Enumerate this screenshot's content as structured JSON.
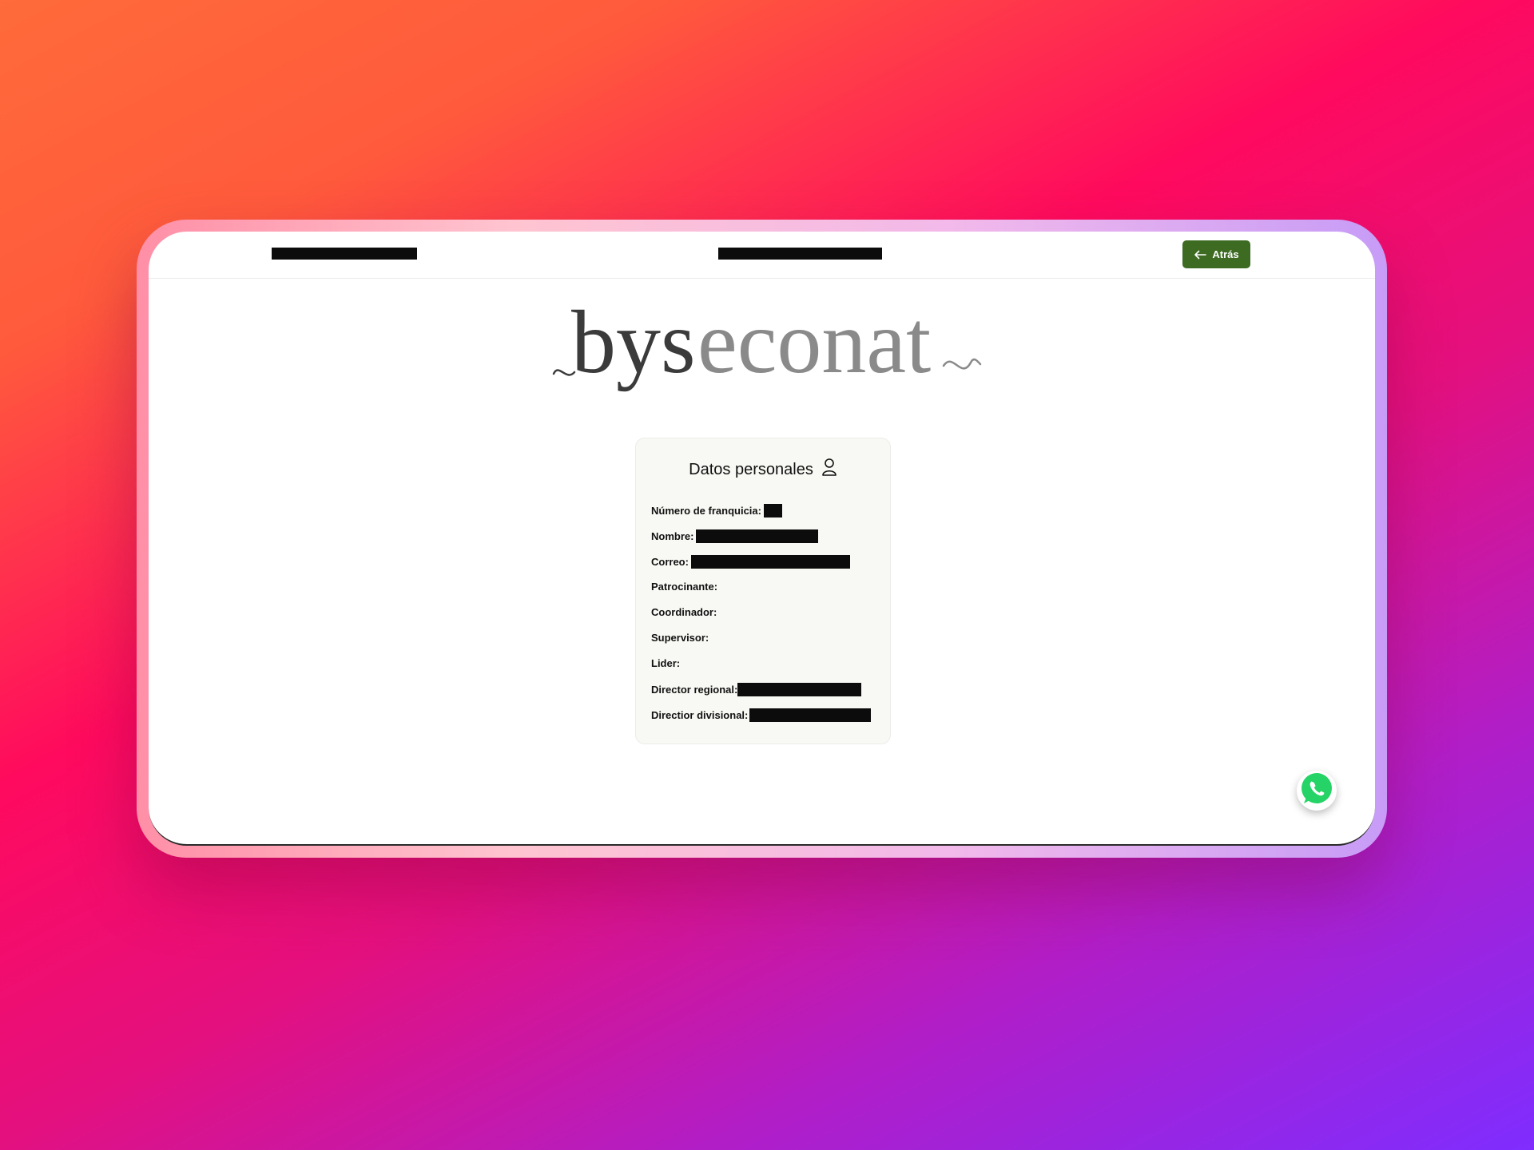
{
  "header": {
    "back_label": "Atrás"
  },
  "brand": {
    "logo_part1": "bys",
    "logo_part2": "econat",
    "color_dark": "#3b3b3b",
    "color_light": "#8a8a8a"
  },
  "card": {
    "title": "Datos personales",
    "fields": [
      {
        "label": "Número de franquicia:",
        "redacted": true
      },
      {
        "label": "Nombre:",
        "redacted": true
      },
      {
        "label": "Correo:",
        "redacted": true
      },
      {
        "label": "Patrocinante:",
        "redacted": false
      },
      {
        "label": "Coordinador:",
        "redacted": false
      },
      {
        "label": "Supervisor:",
        "redacted": false
      },
      {
        "label": "Lider:",
        "redacted": false
      },
      {
        "label": "Director regional:",
        "redacted": true
      },
      {
        "label": "Directior divisional:",
        "redacted": true
      }
    ]
  },
  "icons": {
    "back": "arrow-left-icon",
    "user": "user-icon",
    "whatsapp": "whatsapp-icon"
  },
  "colors": {
    "accent": "#3d6b22",
    "whatsapp": "#25d366"
  }
}
